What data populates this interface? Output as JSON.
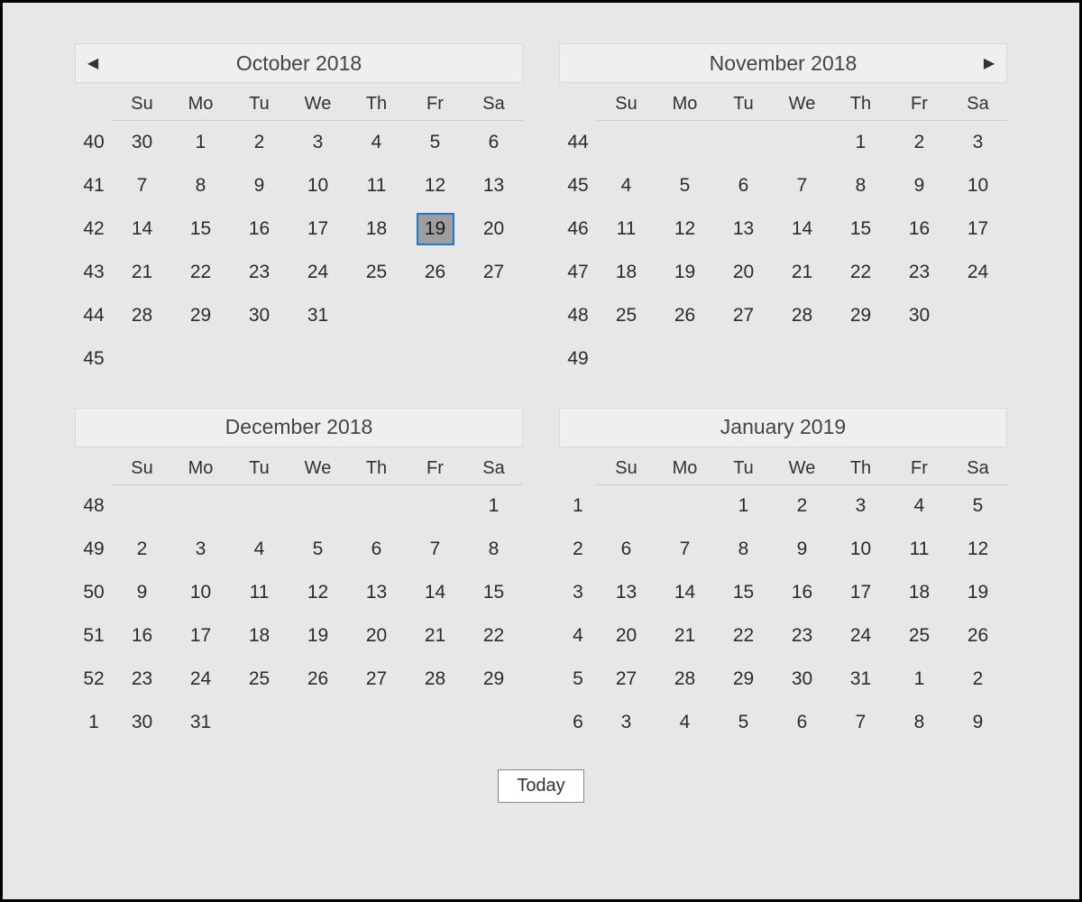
{
  "colors": {
    "weekend": "#bd2f2f",
    "selected_border": "#1e78c8",
    "selected_bg": "#9e9e9e"
  },
  "footer": {
    "today_label": "Today"
  },
  "day_headers": [
    "Su",
    "Mo",
    "Tu",
    "We",
    "Th",
    "Fr",
    "Sa"
  ],
  "months": [
    {
      "id": "oct-2018",
      "title": "October 2018",
      "show_prev_nav": true,
      "show_next_nav": false,
      "rows": [
        {
          "wk": "40",
          "days": [
            {
              "n": "30",
              "cls": "trail"
            },
            {
              "n": "1"
            },
            {
              "n": "2"
            },
            {
              "n": "3"
            },
            {
              "n": "4"
            },
            {
              "n": "5"
            },
            {
              "n": "6",
              "cls": "weekend"
            }
          ]
        },
        {
          "wk": "41",
          "days": [
            {
              "n": "7",
              "cls": "weekend"
            },
            {
              "n": "8"
            },
            {
              "n": "9"
            },
            {
              "n": "10"
            },
            {
              "n": "11"
            },
            {
              "n": "12"
            },
            {
              "n": "13",
              "cls": "weekend"
            }
          ]
        },
        {
          "wk": "42",
          "days": [
            {
              "n": "14",
              "cls": "weekend"
            },
            {
              "n": "15"
            },
            {
              "n": "16"
            },
            {
              "n": "17"
            },
            {
              "n": "18"
            },
            {
              "n": "19",
              "selected": true
            },
            {
              "n": "20",
              "cls": "weekend"
            }
          ]
        },
        {
          "wk": "43",
          "days": [
            {
              "n": "21",
              "cls": "weekend"
            },
            {
              "n": "22"
            },
            {
              "n": "23"
            },
            {
              "n": "24"
            },
            {
              "n": "25"
            },
            {
              "n": "26"
            },
            {
              "n": "27",
              "cls": "weekend"
            }
          ]
        },
        {
          "wk": "44",
          "days": [
            {
              "n": "28",
              "cls": "weekend"
            },
            {
              "n": "29"
            },
            {
              "n": "30"
            },
            {
              "n": "31"
            },
            {
              "n": ""
            },
            {
              "n": ""
            },
            {
              "n": ""
            }
          ]
        },
        {
          "wk": "45",
          "days": [
            {
              "n": ""
            },
            {
              "n": ""
            },
            {
              "n": ""
            },
            {
              "n": ""
            },
            {
              "n": ""
            },
            {
              "n": ""
            },
            {
              "n": ""
            }
          ]
        }
      ]
    },
    {
      "id": "nov-2018",
      "title": "November 2018",
      "show_prev_nav": false,
      "show_next_nav": true,
      "rows": [
        {
          "wk": "44",
          "days": [
            {
              "n": ""
            },
            {
              "n": ""
            },
            {
              "n": ""
            },
            {
              "n": ""
            },
            {
              "n": "1"
            },
            {
              "n": "2"
            },
            {
              "n": "3",
              "cls": "weekend"
            }
          ]
        },
        {
          "wk": "45",
          "days": [
            {
              "n": "4",
              "cls": "weekend"
            },
            {
              "n": "5"
            },
            {
              "n": "6"
            },
            {
              "n": "7"
            },
            {
              "n": "8"
            },
            {
              "n": "9"
            },
            {
              "n": "10",
              "cls": "weekend"
            }
          ]
        },
        {
          "wk": "46",
          "days": [
            {
              "n": "11",
              "cls": "weekend"
            },
            {
              "n": "12"
            },
            {
              "n": "13"
            },
            {
              "n": "14"
            },
            {
              "n": "15"
            },
            {
              "n": "16"
            },
            {
              "n": "17",
              "cls": "weekend"
            }
          ]
        },
        {
          "wk": "47",
          "days": [
            {
              "n": "18",
              "cls": "weekend"
            },
            {
              "n": "19"
            },
            {
              "n": "20"
            },
            {
              "n": "21"
            },
            {
              "n": "22"
            },
            {
              "n": "23"
            },
            {
              "n": "24",
              "cls": "weekend"
            }
          ]
        },
        {
          "wk": "48",
          "days": [
            {
              "n": "25",
              "cls": "weekend"
            },
            {
              "n": "26"
            },
            {
              "n": "27"
            },
            {
              "n": "28"
            },
            {
              "n": "29"
            },
            {
              "n": "30"
            },
            {
              "n": ""
            }
          ]
        },
        {
          "wk": "49",
          "days": [
            {
              "n": ""
            },
            {
              "n": ""
            },
            {
              "n": ""
            },
            {
              "n": ""
            },
            {
              "n": ""
            },
            {
              "n": ""
            },
            {
              "n": ""
            }
          ]
        }
      ]
    },
    {
      "id": "dec-2018",
      "title": "December 2018",
      "show_prev_nav": false,
      "show_next_nav": false,
      "rows": [
        {
          "wk": "48",
          "days": [
            {
              "n": ""
            },
            {
              "n": ""
            },
            {
              "n": ""
            },
            {
              "n": ""
            },
            {
              "n": ""
            },
            {
              "n": ""
            },
            {
              "n": "1",
              "cls": "weekend"
            }
          ]
        },
        {
          "wk": "49",
          "days": [
            {
              "n": "2",
              "cls": "weekend"
            },
            {
              "n": "3"
            },
            {
              "n": "4"
            },
            {
              "n": "5"
            },
            {
              "n": "6"
            },
            {
              "n": "7"
            },
            {
              "n": "8",
              "cls": "weekend"
            }
          ]
        },
        {
          "wk": "50",
          "days": [
            {
              "n": "9",
              "cls": "weekend"
            },
            {
              "n": "10"
            },
            {
              "n": "11"
            },
            {
              "n": "12"
            },
            {
              "n": "13"
            },
            {
              "n": "14"
            },
            {
              "n": "15",
              "cls": "weekend"
            }
          ]
        },
        {
          "wk": "51",
          "days": [
            {
              "n": "16",
              "cls": "weekend"
            },
            {
              "n": "17"
            },
            {
              "n": "18"
            },
            {
              "n": "19"
            },
            {
              "n": "20"
            },
            {
              "n": "21"
            },
            {
              "n": "22",
              "cls": "weekend"
            }
          ]
        },
        {
          "wk": "52",
          "days": [
            {
              "n": "23",
              "cls": "weekend"
            },
            {
              "n": "24"
            },
            {
              "n": "25"
            },
            {
              "n": "26"
            },
            {
              "n": "27"
            },
            {
              "n": "28"
            },
            {
              "n": "29",
              "cls": "weekend"
            }
          ]
        },
        {
          "wk": "1",
          "days": [
            {
              "n": "30",
              "cls": "weekend"
            },
            {
              "n": "31"
            },
            {
              "n": ""
            },
            {
              "n": ""
            },
            {
              "n": ""
            },
            {
              "n": ""
            },
            {
              "n": ""
            }
          ]
        }
      ]
    },
    {
      "id": "jan-2019",
      "title": "January 2019",
      "show_prev_nav": false,
      "show_next_nav": false,
      "rows": [
        {
          "wk": "1",
          "days": [
            {
              "n": ""
            },
            {
              "n": ""
            },
            {
              "n": "1"
            },
            {
              "n": "2"
            },
            {
              "n": "3"
            },
            {
              "n": "4"
            },
            {
              "n": "5",
              "cls": "weekend"
            }
          ]
        },
        {
          "wk": "2",
          "days": [
            {
              "n": "6",
              "cls": "weekend"
            },
            {
              "n": "7"
            },
            {
              "n": "8"
            },
            {
              "n": "9"
            },
            {
              "n": "10"
            },
            {
              "n": "11"
            },
            {
              "n": "12",
              "cls": "weekend"
            }
          ]
        },
        {
          "wk": "3",
          "days": [
            {
              "n": "13",
              "cls": "weekend"
            },
            {
              "n": "14"
            },
            {
              "n": "15"
            },
            {
              "n": "16"
            },
            {
              "n": "17"
            },
            {
              "n": "18"
            },
            {
              "n": "19",
              "cls": "weekend"
            }
          ]
        },
        {
          "wk": "4",
          "days": [
            {
              "n": "20",
              "cls": "weekend"
            },
            {
              "n": "21"
            },
            {
              "n": "22"
            },
            {
              "n": "23"
            },
            {
              "n": "24"
            },
            {
              "n": "25"
            },
            {
              "n": "26",
              "cls": "weekend"
            }
          ]
        },
        {
          "wk": "5",
          "days": [
            {
              "n": "27",
              "cls": "weekend"
            },
            {
              "n": "28"
            },
            {
              "n": "29"
            },
            {
              "n": "30"
            },
            {
              "n": "31"
            },
            {
              "n": "1",
              "cls": "trail-grey"
            },
            {
              "n": "2",
              "cls": "trail"
            }
          ]
        },
        {
          "wk": "6",
          "days": [
            {
              "n": "3",
              "cls": "trail"
            },
            {
              "n": "4",
              "cls": "trail-grey"
            },
            {
              "n": "5",
              "cls": "trail-grey"
            },
            {
              "n": "6",
              "cls": "trail-grey"
            },
            {
              "n": "7",
              "cls": "trail-grey"
            },
            {
              "n": "8",
              "cls": "trail-grey"
            },
            {
              "n": "9",
              "cls": "trail"
            }
          ]
        }
      ]
    }
  ]
}
